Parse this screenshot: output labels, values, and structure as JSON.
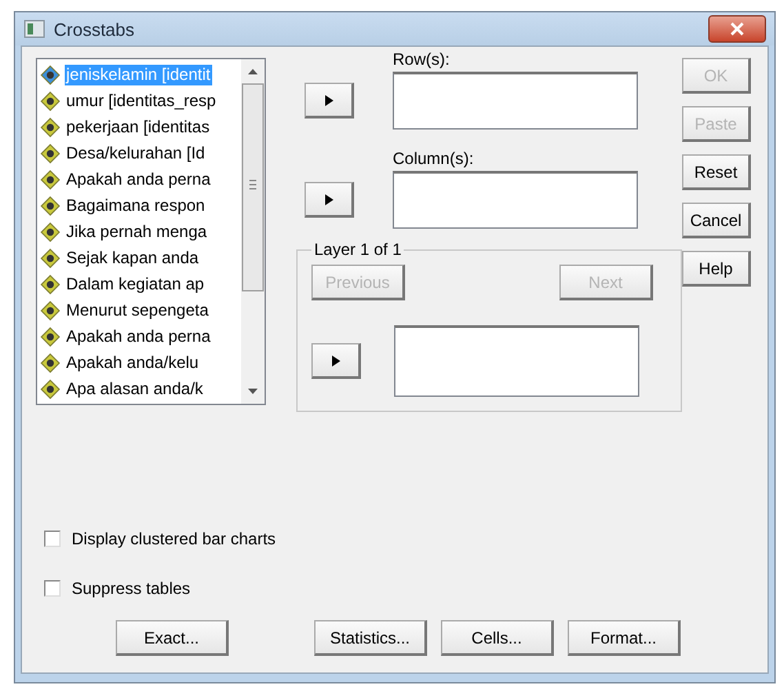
{
  "window": {
    "title": "Crosstabs"
  },
  "variables": [
    {
      "label": "jeniskelamin [identit",
      "selected": true
    },
    {
      "label": "umur [identitas_resp",
      "selected": false
    },
    {
      "label": "pekerjaan [identitas",
      "selected": false
    },
    {
      "label": "Desa/kelurahan [Id",
      "selected": false
    },
    {
      "label": "Apakah anda perna",
      "selected": false
    },
    {
      "label": "Bagaimana respon",
      "selected": false
    },
    {
      "label": "Jika pernah menga",
      "selected": false
    },
    {
      "label": "Sejak kapan anda",
      "selected": false
    },
    {
      "label": "Dalam kegiatan ap",
      "selected": false
    },
    {
      "label": "Menurut sepengeta",
      "selected": false
    },
    {
      "label": "Apakah anda perna",
      "selected": false
    },
    {
      "label": "Apakah anda/kelu",
      "selected": false
    },
    {
      "label": "Apa alasan anda/k",
      "selected": false
    }
  ],
  "rows": {
    "label": "Row(s):"
  },
  "columns": {
    "label": "Column(s):"
  },
  "layer": {
    "title": "Layer 1 of 1",
    "previous": {
      "label": "Previous",
      "disabled": true
    },
    "next": {
      "label": "Next",
      "disabled": true
    }
  },
  "side_buttons": [
    {
      "label": "OK",
      "disabled": true
    },
    {
      "label": "Paste",
      "disabled": true
    },
    {
      "label": "Reset",
      "disabled": false
    },
    {
      "label": "Cancel",
      "disabled": false
    },
    {
      "label": "Help",
      "disabled": false
    }
  ],
  "options": [
    {
      "label": "Display clustered bar charts",
      "checked": false
    },
    {
      "label": "Suppress tables",
      "checked": false
    }
  ],
  "bottom_buttons": [
    "Exact...",
    "Statistics...",
    "Cells...",
    "Format..."
  ]
}
